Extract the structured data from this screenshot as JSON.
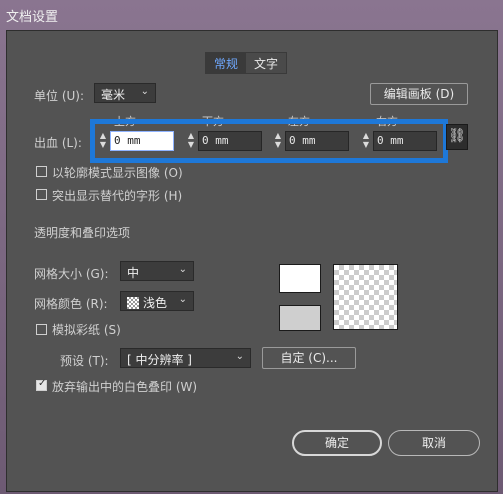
{
  "window": {
    "title": "文档设置"
  },
  "tabs": [
    {
      "label": "常规"
    },
    {
      "label": "文字"
    }
  ],
  "units": {
    "label": "单位 (U):",
    "value": "毫米"
  },
  "edit_artboards_label": "编辑画板 (D)",
  "bleed": {
    "label": "出血 (L):",
    "top": {
      "label": "上方",
      "value": "0 mm"
    },
    "bottom": {
      "label": "下方",
      "value": "0 mm"
    },
    "left": {
      "label": "左方",
      "value": "0 mm"
    },
    "right": {
      "label": "右方",
      "value": "0 mm"
    }
  },
  "options": {
    "outline_mode": "以轮廓模式显示图像 (O)",
    "highlight_substituted": "突出显示替代的字形 (H)"
  },
  "transparency": {
    "section_title": "透明度和叠印选项",
    "grid_size": {
      "label": "网格大小 (G):",
      "value": "中"
    },
    "grid_color": {
      "label": "网格颜色 (R):",
      "value": "浅色"
    },
    "simulate_paper": "模拟彩纸 (S)",
    "preset": {
      "label": "预设 (T):",
      "value": "[ 中分辨率 ]"
    },
    "custom_label": "自定 (C)...",
    "discard_white": "放弃输出中的白色叠印 (W)"
  },
  "footer": {
    "ok": "确定",
    "cancel": "取消"
  },
  "colors": {
    "accent": "#1e78d8",
    "dialog_bg": "#535353"
  }
}
